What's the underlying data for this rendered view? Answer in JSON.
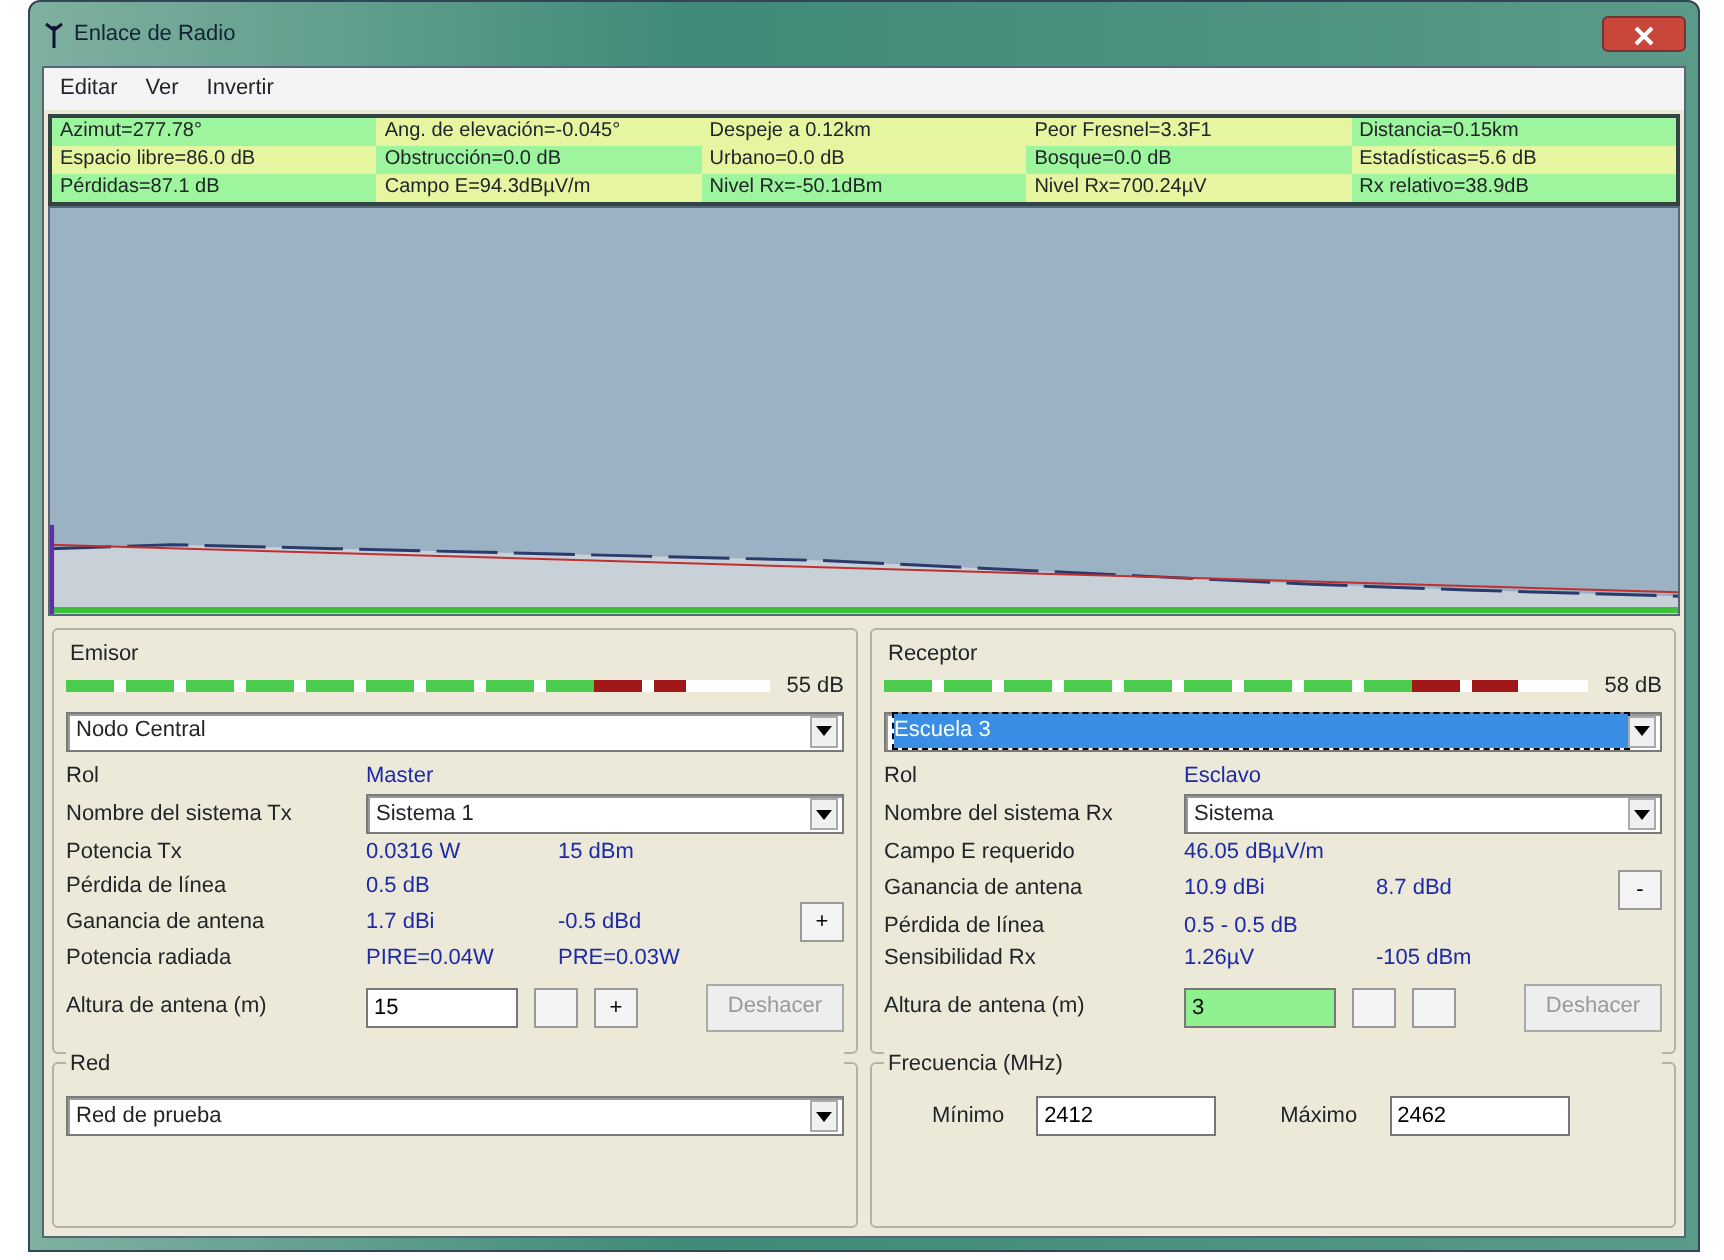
{
  "window": {
    "title": "Enlace de Radio"
  },
  "menu": [
    "Editar",
    "Ver",
    "Invertir"
  ],
  "summary": [
    {
      "text": "Azimut=277.78°",
      "color": "#9df59d"
    },
    {
      "text": "Ang. de elevación=-0.045°",
      "color": "#e6f5a0"
    },
    {
      "text": "Despeje a 0.12km",
      "color": "#e6f5a0"
    },
    {
      "text": "Peor Fresnel=3.3F1",
      "color": "#e6f5a0"
    },
    {
      "text": "Distancia=0.15km",
      "color": "#9df59d"
    },
    {
      "text": "Espacio libre=86.0 dB",
      "color": "#e6f5a0"
    },
    {
      "text": "Obstrucción=0.0 dB",
      "color": "#9df59d"
    },
    {
      "text": "Urbano=0.0 dB",
      "color": "#e6f5a0"
    },
    {
      "text": "Bosque=0.0 dB",
      "color": "#9df59d"
    },
    {
      "text": "Estadísticas=5.6 dB",
      "color": "#e6f5a0"
    },
    {
      "text": "Pérdidas=87.1 dB",
      "color": "#9df59d"
    },
    {
      "text": "Campo E=94.3dBµV/m",
      "color": "#e6f5a0"
    },
    {
      "text": "Nivel Rx=-50.1dBm",
      "color": "#9df59d"
    },
    {
      "text": "Nivel Rx=700.24µV",
      "color": "#e6f5a0"
    },
    {
      "text": "Rx relativo=38.9dB",
      "color": "#9df59d"
    }
  ],
  "panels": [
    {
      "title": "Emisor",
      "level": 0.88,
      "reading": "55 dB",
      "unit": {
        "value": "Nodo Central",
        "selected": false
      },
      "rows": [
        {
          "kind": "text",
          "label": "Rol",
          "value": "Master"
        },
        {
          "kind": "select",
          "label": "Nombre del sistema Tx",
          "value": "Sistema 1"
        },
        {
          "kind": "text",
          "label": "Potencia Tx",
          "value": "0.0316 W",
          "value2": "15 dBm"
        },
        {
          "kind": "text",
          "label": "Pérdida de línea",
          "value": "0.5 dB"
        },
        {
          "kind": "button",
          "label": "Ganancia de antena",
          "value": "1.7 dBi",
          "value2": "-0.5 dBd",
          "button": "+"
        },
        {
          "kind": "text",
          "label": "Potencia radiada",
          "value": "PIRE=0.04W",
          "value2": "PRE=0.03W"
        }
      ],
      "height": {
        "label": "Altura de antena (m)",
        "value": "15",
        "highlight": false,
        "step": "+",
        "undo": "Deshacer"
      },
      "bottom": {
        "title": "Red",
        "kind": "select",
        "value": "Red de prueba"
      }
    },
    {
      "title": "Receptor",
      "level": 0.9,
      "reading": "58 dB",
      "unit": {
        "value": "Escuela 3",
        "selected": true
      },
      "rows": [
        {
          "kind": "text",
          "label": "Rol",
          "value": "Esclavo"
        },
        {
          "kind": "select",
          "label": "Nombre del sistema Rx",
          "value": "Sistema"
        },
        {
          "kind": "text",
          "label": "Campo E requerido",
          "value": "46.05 dBµV/m"
        },
        {
          "kind": "button",
          "label": "Ganancia de antena",
          "value": "10.9 dBi",
          "value2": "8.7 dBd",
          "button": "-"
        },
        {
          "kind": "text",
          "label": "Pérdida de línea",
          "value": "0.5 - 0.5 dB"
        },
        {
          "kind": "text",
          "label": "Sensibilidad Rx",
          "value": "1.26µV",
          "value2": "-105 dBm"
        }
      ],
      "height": {
        "label": "Altura de antena (m)",
        "value": "3",
        "highlight": true,
        "undo": "Deshacer"
      },
      "bottom": {
        "title": "Frecuencia (MHz)",
        "kind": "range",
        "min_label": "Mínimo",
        "min": "2412",
        "max_label": "Máximo",
        "max": "2462"
      }
    }
  ]
}
